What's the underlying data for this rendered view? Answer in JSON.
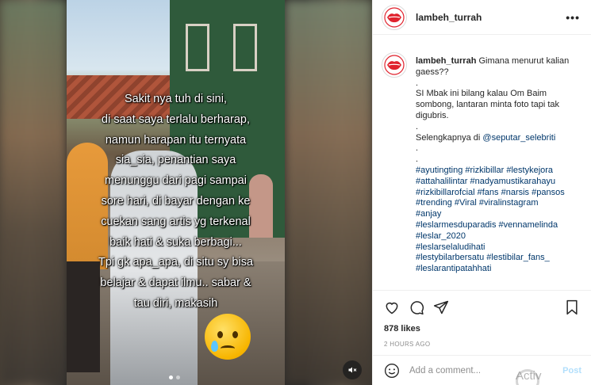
{
  "media": {
    "caption_lines": [
      "Sakit nya tuh di sini,",
      "di saat saya terlalu berharap,",
      "namun harapan itu ternyata",
      "sia_sia, penantian saya",
      "menunggu dari pagi sampai",
      "sore hari, di bayar dengan ke",
      "cuekan sang artis yg terkenal",
      "baik hati & suka berbagi...",
      "Tpi gk apa_apa, di situ sy bisa",
      "belajar & dapat ilmu.. sabar &",
      "tau diri, makasih"
    ],
    "emoji": "crying-face",
    "mute_icon": "speaker-muted-icon"
  },
  "post": {
    "username": "lambeh_turrah",
    "more_icon": "ellipsis-icon",
    "caption": {
      "username": "lambeh_turrah",
      "lines": [
        {
          "text": "Gimana menurut kalian gaess??",
          "inline": true
        },
        {
          "text": "."
        },
        {
          "text": "SI Mbak ini bilang kalau Om Baim sombong, lantaran minta foto tapi tak digubris."
        },
        {
          "text": "."
        },
        {
          "text": "Selengkapnya di ",
          "link": "@seputar_selebriti"
        },
        {
          "text": "."
        },
        {
          "text": "."
        },
        {
          "link": "#ayutingting #rizkibillar #lestykejora #attahalilintar #nadyamustikarahayu #rizkibillarofcial #fans #narsis #pansos #trending #Viral #viralinstagram"
        },
        {
          "link": "#anjay"
        },
        {
          "link": "#leslarmesduparadis #vennamelinda"
        },
        {
          "link": "#leslar_2020"
        },
        {
          "link": "#leslarselaludihati"
        },
        {
          "link": "#lestybilarbersatu #lestibilar_fans_"
        },
        {
          "link": "#leslarantipatahhati"
        }
      ]
    },
    "likes": "878 likes",
    "timestamp": "2 HOURS AGO",
    "comment_placeholder": "Add a comment...",
    "post_button": "Post"
  },
  "overlay": {
    "activate_text": "Activ"
  },
  "colors": {
    "link": "#00376b",
    "text": "#262626",
    "muted": "#8e8e8e",
    "post_disabled": "#b2dffc",
    "avatar_lips": "#e0232e"
  }
}
